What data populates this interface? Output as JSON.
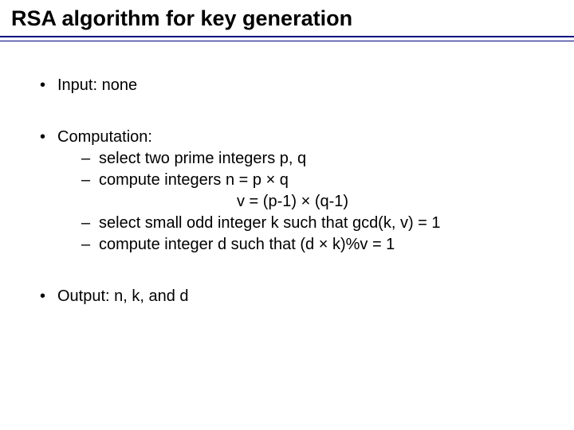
{
  "title": "RSA algorithm for key generation",
  "bullets": {
    "input": "Input: none",
    "computation": "Computation:",
    "comp_items": [
      "select two prime integers p, q",
      "compute integers  n = p × q",
      "v = (p-1) × (q-1)",
      "select small odd integer k such that gcd(k, v) = 1",
      "compute integer d such that (d × k)%v = 1"
    ],
    "output": "Output:  n, k, and d"
  }
}
